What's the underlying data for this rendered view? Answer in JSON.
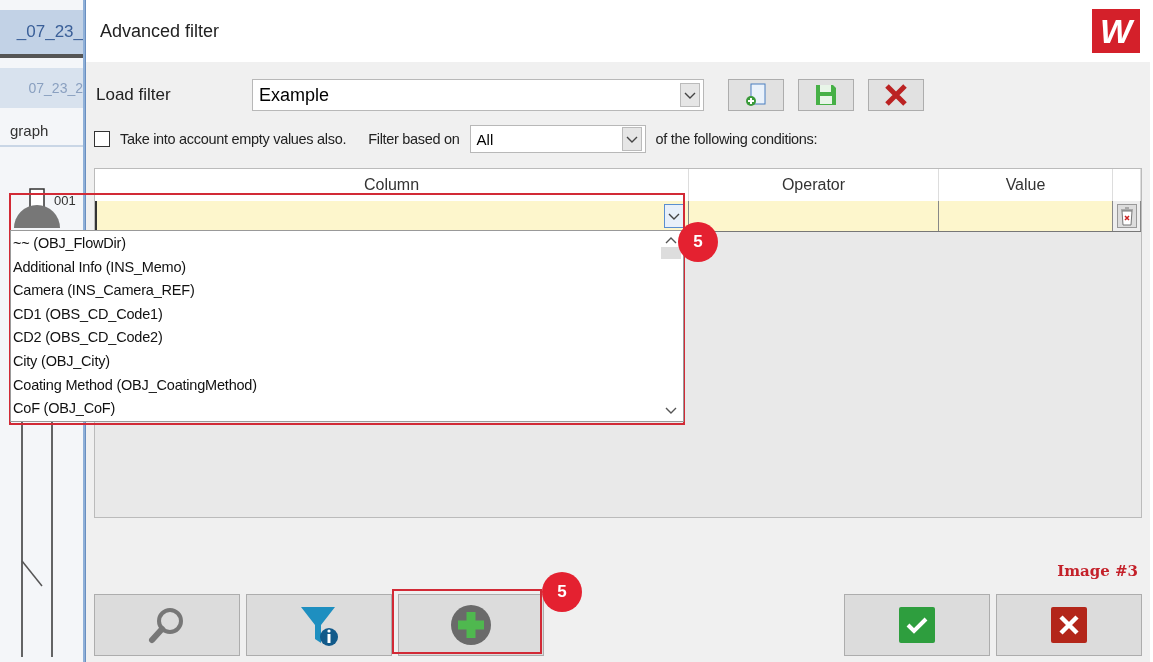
{
  "background": {
    "tabs": [
      {
        "label": "_07_23_",
        "selected": true
      },
      {
        "label": "07_23_2",
        "selected": false
      }
    ],
    "label": "graph",
    "node_label": "001"
  },
  "window": {
    "title": "Advanced filter",
    "logo": "W"
  },
  "load_filter": {
    "label": "Load filter",
    "value": "Example"
  },
  "empty_values": {
    "label": "Take into account empty values also.",
    "checked": false
  },
  "filter_based_on": {
    "label": "Filter based on",
    "value": "All",
    "suffix": "of the following conditions:"
  },
  "grid": {
    "columns": [
      "Column",
      "Operator",
      "Value"
    ]
  },
  "column_dropdown": {
    "open": true,
    "options": [
      "~~ (OBJ_FlowDir)",
      "Additional Info (INS_Memo)",
      "Camera (INS_Camera_REF)",
      "CD1 (OBS_CD_Code1)",
      "CD2 (OBS_CD_Code2)",
      "City (OBJ_City)",
      "Coating Method (OBJ_CoatingMethod)",
      "CoF (OBJ_CoF)"
    ]
  },
  "annotations": [
    {
      "number": "5"
    },
    {
      "number": "5"
    }
  ],
  "caption": "Image #3"
}
